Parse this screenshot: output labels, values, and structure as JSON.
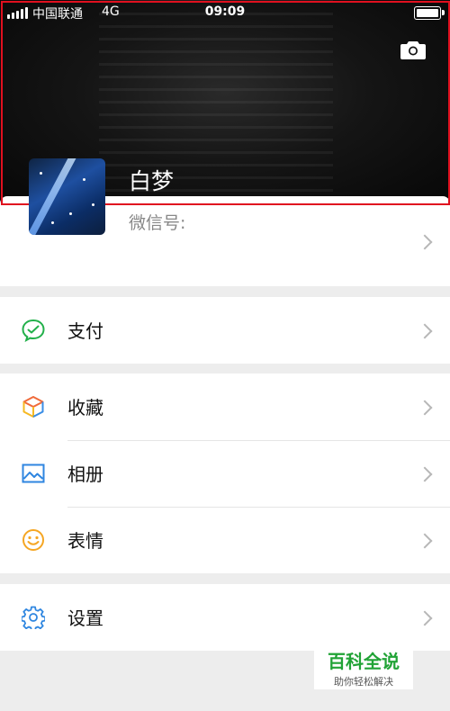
{
  "status_bar": {
    "carrier": "中国联通",
    "network": "4G",
    "time": "09:09"
  },
  "profile": {
    "name": "白梦",
    "wechat_id_label": "微信号:"
  },
  "menu_groups": [
    {
      "items": [
        {
          "label": "支付",
          "icon": "pay-icon"
        }
      ]
    },
    {
      "items": [
        {
          "label": "收藏",
          "icon": "favorites-cube-icon"
        },
        {
          "label": "相册",
          "icon": "album-picture-icon"
        },
        {
          "label": "表情",
          "icon": "sticker-smiley-icon"
        }
      ]
    },
    {
      "items": [
        {
          "label": "设置",
          "icon": "settings-gear-icon"
        }
      ]
    }
  ],
  "watermark": {
    "title": "百科全说",
    "subtitle": "助你轻松解决"
  },
  "colors": {
    "highlight_border": "#e0101f",
    "pay_green": "#22b04a",
    "watermark_green": "#21a336"
  }
}
